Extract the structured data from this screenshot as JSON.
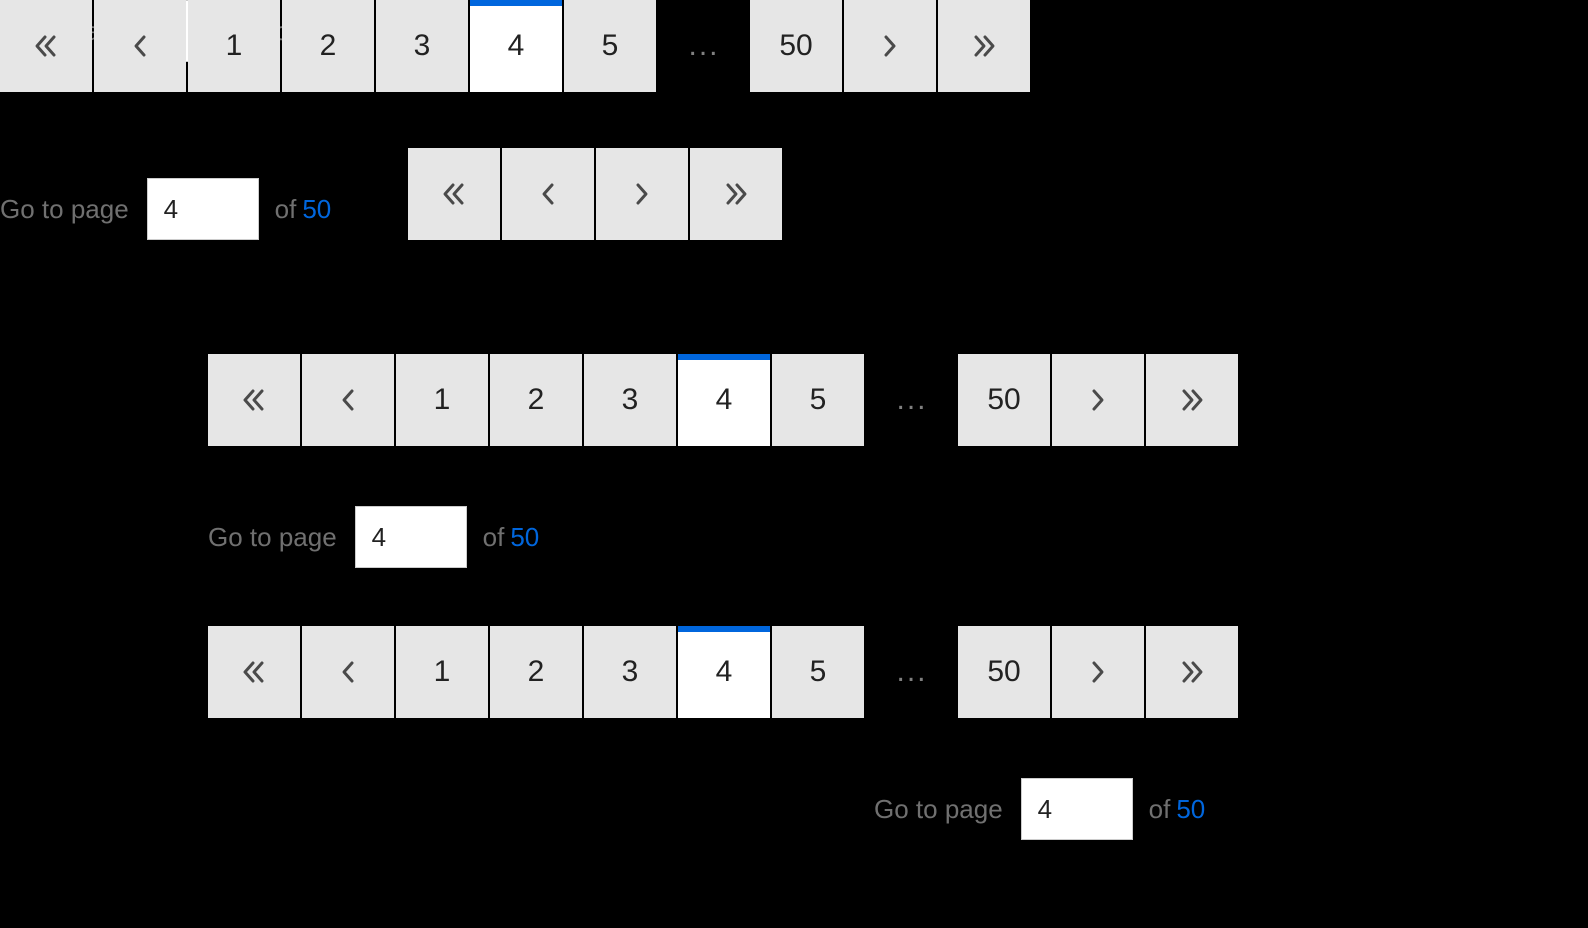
{
  "goto": {
    "label": "Go to page",
    "value": "4",
    "of": "of",
    "total": "50"
  },
  "pager": {
    "pages": [
      "1",
      "2",
      "3",
      "4",
      "5"
    ],
    "current": "4",
    "ellipsis": "...",
    "last": "50"
  }
}
